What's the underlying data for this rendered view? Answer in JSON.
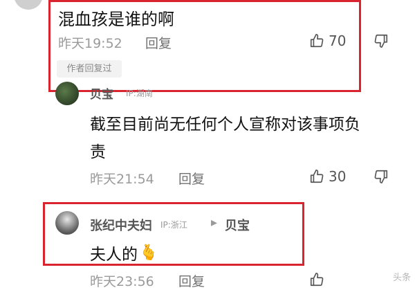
{
  "comments": [
    {
      "text": "混血孩是谁的啊",
      "time": "昨天19:52",
      "reply_label": "回复",
      "likes": "70",
      "author_tag": "作者回复过"
    },
    {
      "username": "贝宝",
      "ip": "IP:湖南",
      "text_line1": "截至目前尚无任何个人宣称对该事项负",
      "text_line2": "责",
      "time": "昨天21:54",
      "reply_label": "回复",
      "likes": "30"
    },
    {
      "username": "张纪中夫妇",
      "ip": "IP:浙江",
      "reply_to_arrow": "▸",
      "reply_to": "贝宝",
      "text": "夫人的",
      "emoji": "🫰",
      "time": "昨天23:56",
      "reply_label": "回复"
    }
  ],
  "watermark": "头条"
}
